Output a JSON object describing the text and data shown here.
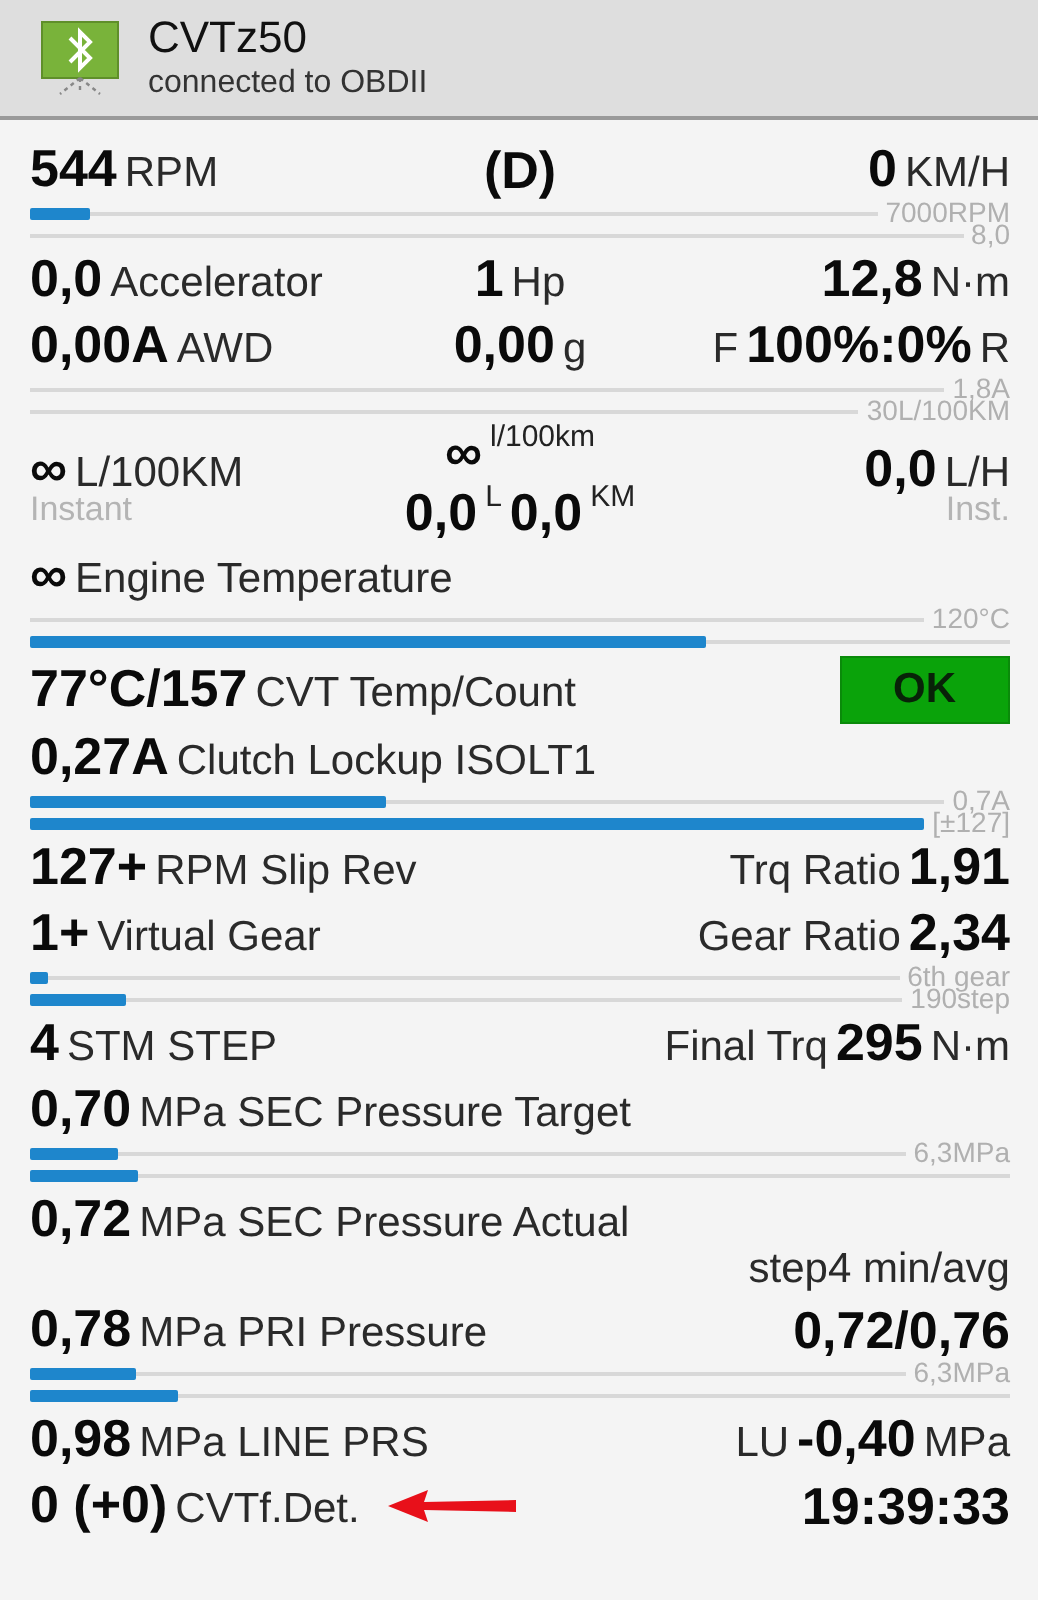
{
  "header": {
    "title": "CVTz50",
    "subtitle": "connected to OBDII"
  },
  "blocks": [
    {
      "kind": "row",
      "cells": [
        {
          "lines": [
            [
              {
                "kind": "value",
                "text": "544"
              },
              {
                "kind": "unit",
                "text": "RPM"
              }
            ]
          ]
        },
        {
          "lines": [
            [
              {
                "kind": "value",
                "text": "(D)"
              }
            ]
          ]
        },
        {
          "lines": [
            [
              {
                "kind": "value",
                "text": "0"
              },
              {
                "kind": "unit",
                "text": "KM/H"
              }
            ]
          ]
        }
      ]
    },
    {
      "kind": "bar",
      "level": 0.07,
      "label": "7000RPM"
    },
    {
      "kind": "bar",
      "label": "8,0"
    },
    {
      "kind": "row",
      "cells": [
        {
          "lines": [
            [
              {
                "kind": "value",
                "text": "0,0"
              },
              {
                "kind": "unit",
                "text": "Accelerator"
              }
            ]
          ]
        },
        {
          "lines": [
            [
              {
                "kind": "value",
                "text": "1"
              },
              {
                "kind": "unit",
                "text": "Hp"
              }
            ]
          ]
        },
        {
          "lines": [
            [
              {
                "kind": "value",
                "text": "12,8"
              },
              {
                "kind": "unit",
                "text": "N·m"
              }
            ]
          ]
        }
      ]
    },
    {
      "kind": "row",
      "cells": [
        {
          "lines": [
            [
              {
                "kind": "value",
                "text": "0,00A"
              },
              {
                "kind": "unit",
                "text": "AWD"
              }
            ]
          ]
        },
        {
          "lines": [
            [
              {
                "kind": "value",
                "text": "0,00"
              },
              {
                "kind": "unit",
                "text": "g"
              }
            ]
          ]
        },
        {
          "lines": [
            [
              {
                "kind": "unit",
                "text": "F"
              },
              {
                "kind": "value",
                "text": "100%:0%"
              },
              {
                "kind": "unit",
                "text": "R"
              }
            ]
          ]
        }
      ]
    },
    {
      "kind": "bar",
      "label": "1,8A"
    },
    {
      "kind": "bar",
      "label": "30L/100KM"
    },
    {
      "kind": "row",
      "cells": [
        {
          "lines": [
            [
              {
                "kind": "value",
                "text": "∞"
              },
              {
                "kind": "unit",
                "text": "L/100KM"
              }
            ],
            [
              {
                "kind": "note",
                "text": "Instant"
              }
            ]
          ]
        },
        {
          "lines": [
            [
              {
                "kind": "value",
                "text": "∞"
              },
              {
                "kind": "sup",
                "text": "l/100km"
              }
            ],
            [
              {
                "kind": "value",
                "text": "0,0"
              },
              {
                "kind": "sup",
                "text": "L"
              },
              {
                "kind": "value",
                "text": "0,0"
              },
              {
                "kind": "sup",
                "text": "KM"
              }
            ]
          ]
        },
        {
          "lines": [
            [
              {
                "kind": "value",
                "text": "0,0"
              },
              {
                "kind": "unit",
                "text": "L/H"
              }
            ],
            [
              {
                "kind": "note",
                "text": "Inst."
              }
            ]
          ]
        }
      ]
    },
    {
      "kind": "row",
      "cells": [
        {
          "lines": [
            [
              {
                "kind": "value",
                "text": "∞"
              },
              {
                "kind": "unit",
                "text": "Engine Temperature"
              }
            ]
          ]
        }
      ]
    },
    {
      "kind": "bar",
      "label": "120°C"
    },
    {
      "kind": "bar",
      "level": 0.69
    },
    {
      "kind": "row",
      "cells": [
        {
          "lines": [
            [
              {
                "kind": "value",
                "text": "77°C/157"
              },
              {
                "kind": "unit",
                "text": "CVT Temp/Count"
              }
            ]
          ]
        },
        {
          "lines": [
            [
              {
                "kind": "badge",
                "text": "OK"
              }
            ]
          ]
        }
      ]
    },
    {
      "kind": "row",
      "cells": [
        {
          "lines": [
            [
              {
                "kind": "value",
                "text": "0,27A"
              },
              {
                "kind": "unit",
                "text": "Clutch Lockup ISOLT1"
              }
            ]
          ]
        }
      ]
    },
    {
      "kind": "bar",
      "level": 0.39,
      "label": "0,7A"
    },
    {
      "kind": "bar",
      "level": 1,
      "label": "[±127]"
    },
    {
      "kind": "row",
      "cells": [
        {
          "lines": [
            [
              {
                "kind": "value",
                "text": "127+"
              },
              {
                "kind": "unit",
                "text": "RPM Slip Rev"
              }
            ]
          ]
        },
        {
          "lines": [
            [
              {
                "kind": "unit",
                "text": "Trq Ratio"
              },
              {
                "kind": "value",
                "text": "1,91"
              }
            ]
          ]
        }
      ]
    },
    {
      "kind": "row",
      "cells": [
        {
          "lines": [
            [
              {
                "kind": "value",
                "text": "1+"
              },
              {
                "kind": "unit",
                "text": "Virtual Gear"
              }
            ]
          ]
        },
        {
          "lines": [
            [
              {
                "kind": "unit",
                "text": "Gear Ratio"
              },
              {
                "kind": "value",
                "text": "2,34"
              }
            ]
          ]
        }
      ]
    },
    {
      "kind": "bar",
      "level": 0.02,
      "label": "6th gear"
    },
    {
      "kind": "bar",
      "level": 0.11,
      "label": "190step"
    },
    {
      "kind": "row",
      "cells": [
        {
          "lines": [
            [
              {
                "kind": "value",
                "text": "4"
              },
              {
                "kind": "unit",
                "text": "STM STEP"
              }
            ]
          ]
        },
        {
          "lines": [
            [
              {
                "kind": "unit",
                "text": "Final Trq"
              },
              {
                "kind": "value",
                "text": "295"
              },
              {
                "kind": "unit",
                "text": "N·m"
              }
            ]
          ]
        }
      ]
    },
    {
      "kind": "row",
      "cells": [
        {
          "lines": [
            [
              {
                "kind": "value",
                "text": "0,70"
              },
              {
                "kind": "unit",
                "text": "MPa SEC Pressure Target"
              }
            ]
          ]
        }
      ]
    },
    {
      "kind": "bar",
      "level": 0.1,
      "label": "6,3MPa"
    },
    {
      "kind": "bar",
      "level": 0.11
    },
    {
      "kind": "row",
      "cells": [
        {
          "lines": [
            [
              {
                "kind": "value",
                "text": "0,72"
              },
              {
                "kind": "unit",
                "text": "MPa SEC Pressure Actual"
              }
            ]
          ]
        }
      ]
    },
    {
      "kind": "note",
      "text": "step4 min/avg"
    },
    {
      "kind": "row",
      "cells": [
        {
          "lines": [
            [
              {
                "kind": "value",
                "text": "0,78"
              },
              {
                "kind": "unit",
                "text": "MPa PRI Pressure"
              }
            ]
          ]
        },
        {
          "lines": [
            [
              {
                "kind": "value",
                "text": "0,72/0,76"
              }
            ]
          ]
        }
      ]
    },
    {
      "kind": "bar",
      "level": 0.12,
      "label": "6,3MPa"
    },
    {
      "kind": "bar",
      "level": 0.15
    },
    {
      "kind": "row",
      "cells": [
        {
          "lines": [
            [
              {
                "kind": "value",
                "text": "0,98"
              },
              {
                "kind": "unit",
                "text": "MPa LINE PRS"
              }
            ]
          ]
        },
        {
          "lines": [
            [
              {
                "kind": "unit",
                "text": "LU"
              },
              {
                "kind": "value",
                "text": "-0,40"
              },
              {
                "kind": "unit",
                "text": "MPa"
              }
            ]
          ]
        }
      ]
    },
    {
      "kind": "row",
      "cells": [
        {
          "lines": [
            [
              {
                "kind": "value",
                "text": "0 (+0)"
              },
              {
                "kind": "unit",
                "text": "CVTf.Det."
              },
              {
                "kind": "arrow"
              }
            ]
          ]
        },
        {
          "lines": [
            [
              {
                "kind": "value",
                "text": "19:39:33"
              }
            ]
          ]
        }
      ]
    }
  ]
}
